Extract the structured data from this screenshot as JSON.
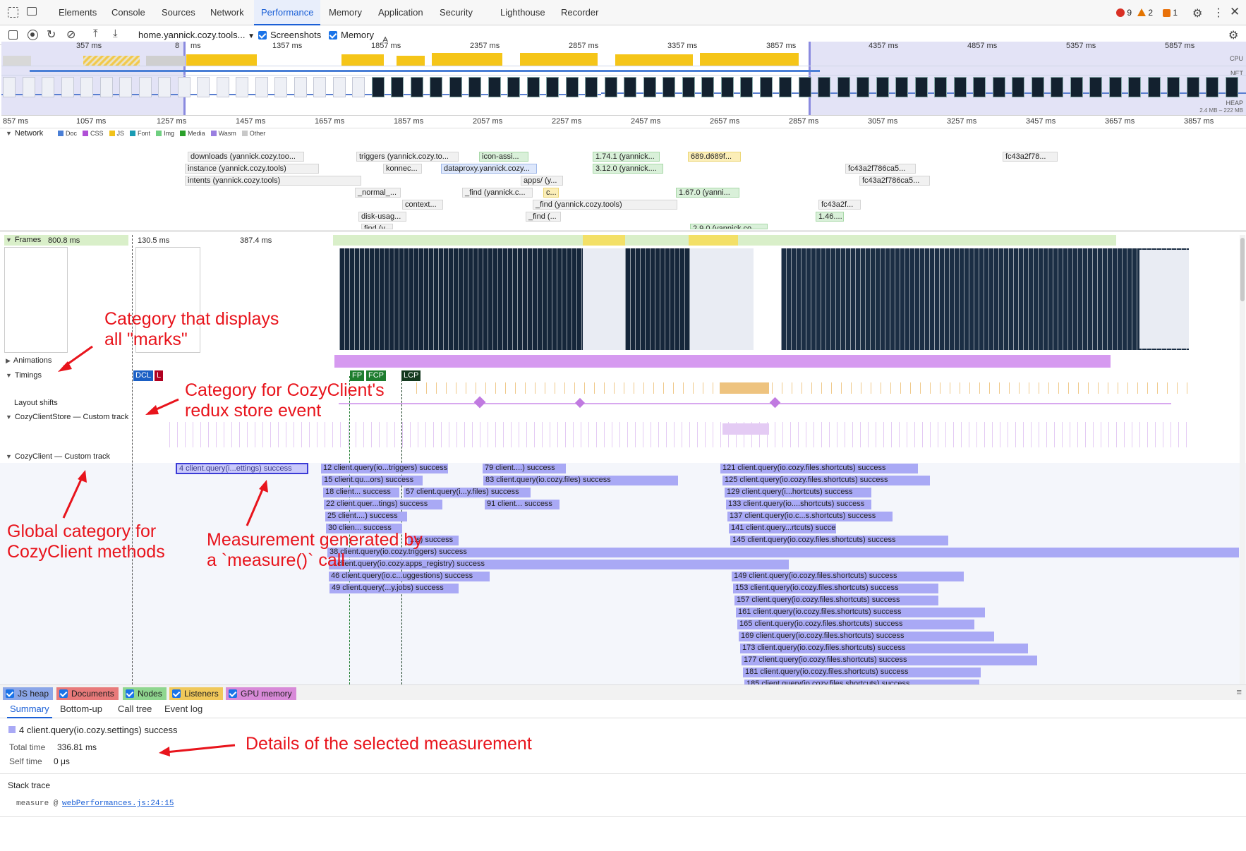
{
  "tabs": [
    "Elements",
    "Console",
    "Sources",
    "Network",
    "Performance",
    "Memory",
    "Application",
    "Security",
    "Lighthouse",
    "Recorder"
  ],
  "active_tab": "Performance",
  "status": {
    "errors": "9",
    "warnings": "2",
    "issues": "1"
  },
  "toolbar": {
    "url": "home.yannick.cozy.tools...",
    "screenshots_label": "Screenshots",
    "memory_label": "Memory"
  },
  "overview": {
    "ticks": [
      "357 ms",
      "8",
      "ms",
      "1357 ms",
      "1857 ms",
      "2357 ms",
      "2857 ms",
      "3357 ms",
      "3857 ms",
      "4357 ms",
      "4857 ms",
      "5357 ms",
      "5857 ms"
    ],
    "labels": {
      "cpu": "CPU",
      "net": "NET",
      "heap": "HEAP",
      "heap_range": "2.4 MB – 222 MB"
    }
  },
  "ruler": [
    "857 ms",
    "1057 ms",
    "1257 ms",
    "1457 ms",
    "1657 ms",
    "1857 ms",
    "2057 ms",
    "2257 ms",
    "2457 ms",
    "2657 ms",
    "2857 ms",
    "3057 ms",
    "3257 ms",
    "3457 ms",
    "3657 ms",
    "3857 ms"
  ],
  "network": {
    "title": "Network",
    "legend": [
      {
        "name": "Doc",
        "color": "#4a7fd6"
      },
      {
        "name": "CSS",
        "color": "#b04fd6"
      },
      {
        "name": "JS",
        "color": "#f1c21b"
      },
      {
        "name": "Font",
        "color": "#1a9bb3"
      },
      {
        "name": "Img",
        "color": "#6fcf80"
      },
      {
        "name": "Media",
        "color": "#2aa02a"
      },
      {
        "name": "Wasm",
        "color": "#9a7fe0"
      },
      {
        "name": "Other",
        "color": "#c8c8c8"
      }
    ],
    "requests": [
      "downloads (yannick.cozy.too...",
      "instance (yannick.cozy.tools)",
      "intents (yannick.cozy.tools)",
      "triggers (yannick.cozy.to...",
      "konnec...",
      "_normal_...",
      "context...",
      "disk-usag...",
      "find (y...",
      "icon-assi...",
      "dataproxy.yannick.cozy...",
      "apps/ (y...",
      "_find (yannick.c...",
      "c...",
      "_find (yannick.cozy.tools)",
      "_find (...",
      "1.74.1 (yannick...",
      "3.12.0 (yannick....",
      "1.67.0 (yanni...",
      "2.9.0 (yannick.co...",
      "689.d689f...",
      "fc43a2f786ca5...",
      "fc43a2f786ca5...",
      "fc43a2f...",
      "1.46....",
      "fc43a2f78..."
    ]
  },
  "frames": {
    "title": "Frames",
    "values": [
      "800.8 ms",
      "130.5 ms",
      "387.4 ms"
    ]
  },
  "tracks": {
    "animations": "Animations",
    "timings": "Timings",
    "timing_marks": [
      "DCL",
      "L",
      "FP",
      "FCP",
      "LCP"
    ],
    "layout_shifts": "Layout shifts",
    "store": "CozyClientStore — Custom track",
    "client": "CozyClient — Custom track"
  },
  "measures": [
    "4 client.query(i...ettings) success",
    "12 client.query(io...triggers) success",
    "15 client.qu...ors) success",
    "18 client... success",
    "57 client.query(i...y.files) success",
    "22 client.quer...tings) success",
    "25 client....) success",
    "30 clien... success",
    "...s) success",
    "38 client.query(io.cozy.triggers) success",
    "...client.query(io.cozy.apps_registry) success",
    "46 client.query(io.c...uggestions) success",
    "49 client.query(...y.jobs) success",
    "79 client....) success",
    "83 client.query(io.cozy.files) success",
    "91 client... success",
    "121 client.query(io.cozy.files.shortcuts) success",
    "125 client.query(io.cozy.files.shortcuts) success",
    "129 client.query(i...hortcuts) success",
    "133 client.query(io....shortcuts) success",
    "137 client.query(io.c...s.shortcuts) success",
    "141 client.query...rtcuts) success",
    "145 client.query(io.cozy.files.shortcuts) success",
    "149 client.query(io.cozy.files.shortcuts) success",
    "153 client.query(io.cozy.files.shortcuts) success",
    "157 client.query(io.cozy.files.shortcuts) success",
    "161 client.query(io.cozy.files.shortcuts) success",
    "165 client.query(io.cozy.files.shortcuts) success",
    "169 client.query(io.cozy.files.shortcuts) success",
    "173 client.query(io.cozy.files.shortcuts) success",
    "177 client.query(io.cozy.files.shortcuts) success",
    "181 client.query(io.cozy.files.shortcuts) success",
    "185 client.query(io.cozy.files.shortcuts) success"
  ],
  "annotations": {
    "marks": [
      "Category that displays",
      "all \"marks\""
    ],
    "redux": [
      "Category for CozyClient's",
      "redux store event"
    ],
    "global": [
      "Global category for",
      "CozyClient methods"
    ],
    "measure": [
      "Measurement generated by",
      "a `measure()` call"
    ],
    "details": "Details of the selected measurement"
  },
  "memory_checkboxes": [
    {
      "label": "JS heap",
      "color": "#8ba6e8"
    },
    {
      "label": "Documents",
      "color": "#e87a7a"
    },
    {
      "label": "Nodes",
      "color": "#8fd68f"
    },
    {
      "label": "Listeners",
      "color": "#f0c85a"
    },
    {
      "label": "GPU memory",
      "color": "#d88ad8"
    }
  ],
  "bottom_tabs": [
    "Summary",
    "Bottom-up",
    "Call tree",
    "Event log"
  ],
  "summary": {
    "title": "4 client.query(io.cozy.settings) success",
    "total_label": "Total time",
    "total_value": "336.81 ms",
    "self_label": "Self time",
    "self_value": "0 μs",
    "stack_title": "Stack trace",
    "stack_fn": "measure @",
    "stack_link": "webPerformances.js:24:15"
  }
}
